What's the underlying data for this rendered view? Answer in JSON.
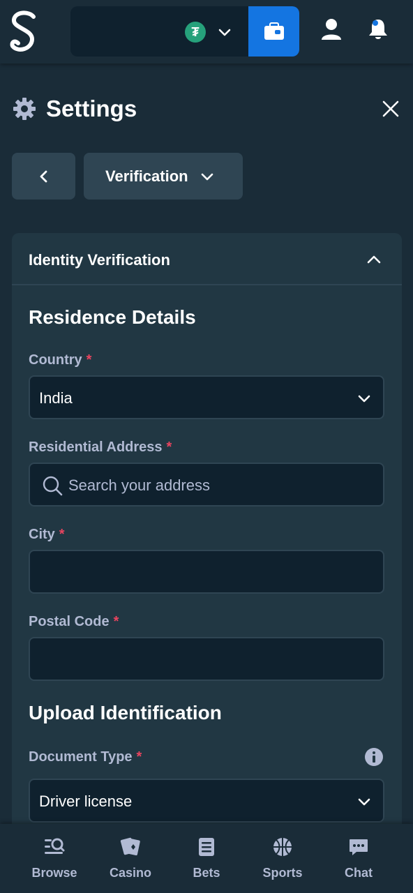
{
  "header": {
    "coin_symbol": "₮",
    "coin_color": "#26a17b",
    "wallet_button_color": "#1475e1"
  },
  "settings": {
    "title": "Settings",
    "section_dropdown": "Verification"
  },
  "card": {
    "header_title": "Identity Verification",
    "residence": {
      "title": "Residence Details",
      "country_label": "Country",
      "country_value": "India",
      "address_label": "Residential Address",
      "address_placeholder": "Search your address",
      "city_label": "City",
      "city_value": "",
      "postal_label": "Postal Code",
      "postal_value": ""
    },
    "upload": {
      "title": "Upload Identification",
      "doc_type_label": "Document Type",
      "doc_type_value": "Driver license"
    },
    "required_mark": "*"
  },
  "bottom_nav": {
    "items": [
      {
        "label": "Browse",
        "icon": "browse-icon"
      },
      {
        "label": "Casino",
        "icon": "casino-cards-icon"
      },
      {
        "label": "Bets",
        "icon": "bets-list-icon"
      },
      {
        "label": "Sports",
        "icon": "basketball-icon"
      },
      {
        "label": "Chat",
        "icon": "chat-icon"
      }
    ]
  },
  "colors": {
    "background": "#1a2c38",
    "card": "#213743",
    "input": "#0f212e",
    "border": "#2f4553",
    "muted_text": "#b1bad3",
    "required": "#e9445f"
  }
}
